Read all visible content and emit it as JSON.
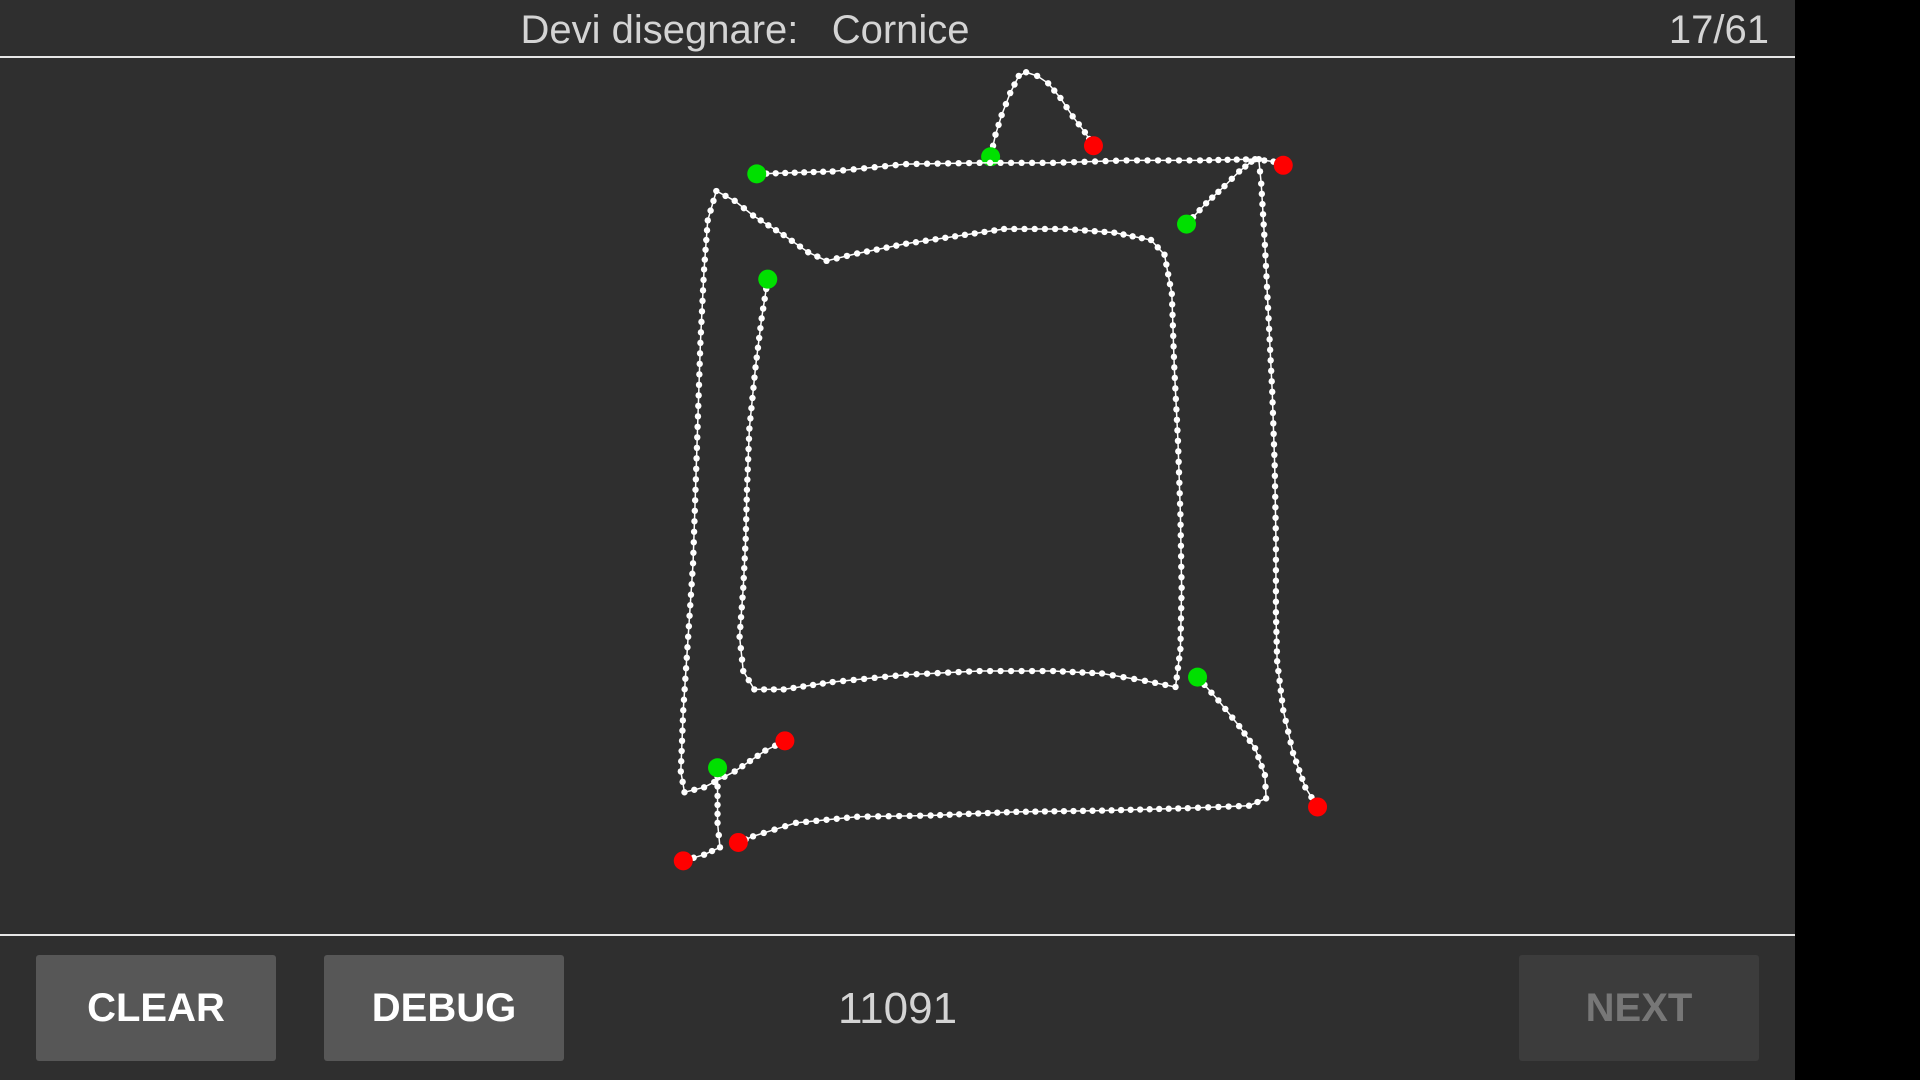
{
  "header": {
    "prompt_label": "Devi disegnare:",
    "target_word": "Cornice",
    "progress": "17/61"
  },
  "toolbar": {
    "clear_label": "CLEAR",
    "debug_label": "DEBUG",
    "score": "11091",
    "next_label": "NEXT",
    "next_enabled": false
  },
  "colors": {
    "background": "#2f2f2f",
    "stroke": "#ffffff",
    "stroke_start": "#00e000",
    "stroke_end": "#ff0000",
    "button": "#575757"
  },
  "icons": {
    "stroke_start_marker": "green-dot",
    "stroke_end_marker": "red-dot"
  }
}
